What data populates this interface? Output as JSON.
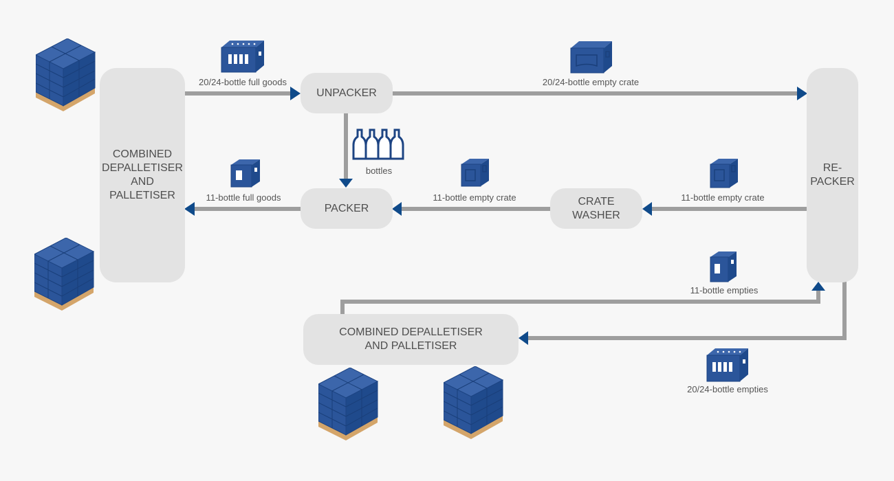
{
  "nodes": {
    "combined_left": "COMBINED\nDEPALLETISER\nAND\nPALLETISER",
    "unpacker": "UNPACKER",
    "packer": "PACKER",
    "crate_washer": "CRATE\nWASHER",
    "repacker": "RE-\nPACKER",
    "combined_bottom": "COMBINED DEPALLETISER\nAND PALLETISER"
  },
  "flows": {
    "full_goods_20_24": "20/24-bottle full goods",
    "empty_crate_20_24": "20/24-bottle empty crate",
    "bottles": "bottles",
    "full_goods_11": "11-bottle full goods",
    "empty_crate_11_packer": "11-bottle empty crate",
    "empty_crate_11_washer": "11-bottle empty crate",
    "empties_11": "11-bottle empties",
    "empties_20_24": "20/24-bottle empties"
  },
  "colors": {
    "accent": "#0f4a8a",
    "crate": "#2b559a",
    "line": "#9e9e9e",
    "node": "#e3e3e3",
    "pallet": "#d4a56a"
  }
}
